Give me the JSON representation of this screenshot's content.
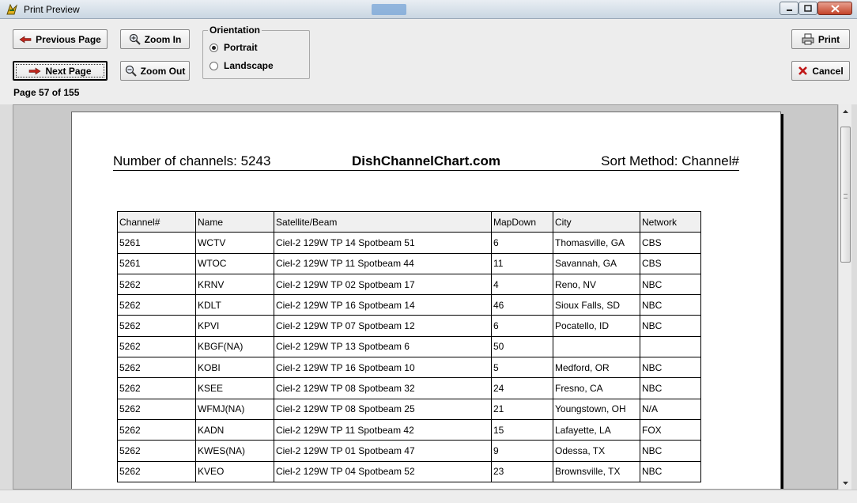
{
  "window": {
    "title": "Print Preview",
    "icon": "app-icon"
  },
  "toolbar": {
    "previous_page": "Previous Page",
    "next_page": "Next Page",
    "zoom_in": "Zoom In",
    "zoom_out": "Zoom Out",
    "print": "Print",
    "cancel": "Cancel",
    "page_indicator": "Page 57 of 155"
  },
  "orientation": {
    "legend": "Orientation",
    "options": [
      "Portrait",
      "Landscape"
    ],
    "selected": "Portrait"
  },
  "report": {
    "header_left": "Number of channels: 5243",
    "header_center": "DishChannelChart.com",
    "header_right": "Sort Method: Channel#",
    "columns": [
      "Channel#",
      "Name",
      "Satellite/Beam",
      "MapDown",
      "City",
      "Network"
    ],
    "rows": [
      [
        "5261",
        "WCTV",
        "Ciel-2 129W TP 14 Spotbeam 51",
        "6",
        "Thomasville, GA",
        "CBS"
      ],
      [
        "5261",
        "WTOC",
        "Ciel-2 129W TP 11 Spotbeam 44",
        "11",
        "Savannah, GA",
        "CBS"
      ],
      [
        "5262",
        "KRNV",
        "Ciel-2 129W TP 02 Spotbeam 17",
        "4",
        "Reno, NV",
        "NBC"
      ],
      [
        "5262",
        "KDLT",
        "Ciel-2 129W TP 16 Spotbeam 14",
        "46",
        "Sioux Falls, SD",
        "NBC"
      ],
      [
        "5262",
        "KPVI",
        "Ciel-2 129W TP 07 Spotbeam 12",
        "6",
        "Pocatello, ID",
        "NBC"
      ],
      [
        "5262",
        "KBGF(NA)",
        "Ciel-2 129W TP 13 Spotbeam 6",
        "50",
        "",
        ""
      ],
      [
        "5262",
        "KOBI",
        "Ciel-2 129W TP 16 Spotbeam 10",
        "5",
        "Medford, OR",
        "NBC"
      ],
      [
        "5262",
        "KSEE",
        "Ciel-2 129W TP 08 Spotbeam 32",
        "24",
        "Fresno, CA",
        "NBC"
      ],
      [
        "5262",
        "WFMJ(NA)",
        "Ciel-2 129W TP 08 Spotbeam 25",
        "21",
        "Youngstown, OH",
        "N/A"
      ],
      [
        "5262",
        "KADN",
        "Ciel-2 129W TP 11 Spotbeam 42",
        "15",
        "Lafayette, LA",
        "FOX"
      ],
      [
        "5262",
        "KWES(NA)",
        "Ciel-2 129W TP 01 Spotbeam 47",
        "9",
        "Odessa, TX",
        "NBC"
      ],
      [
        "5262",
        "KVEO",
        "Ciel-2 129W TP 04 Spotbeam 52",
        "23",
        "Brownsville, TX",
        "NBC"
      ]
    ]
  }
}
